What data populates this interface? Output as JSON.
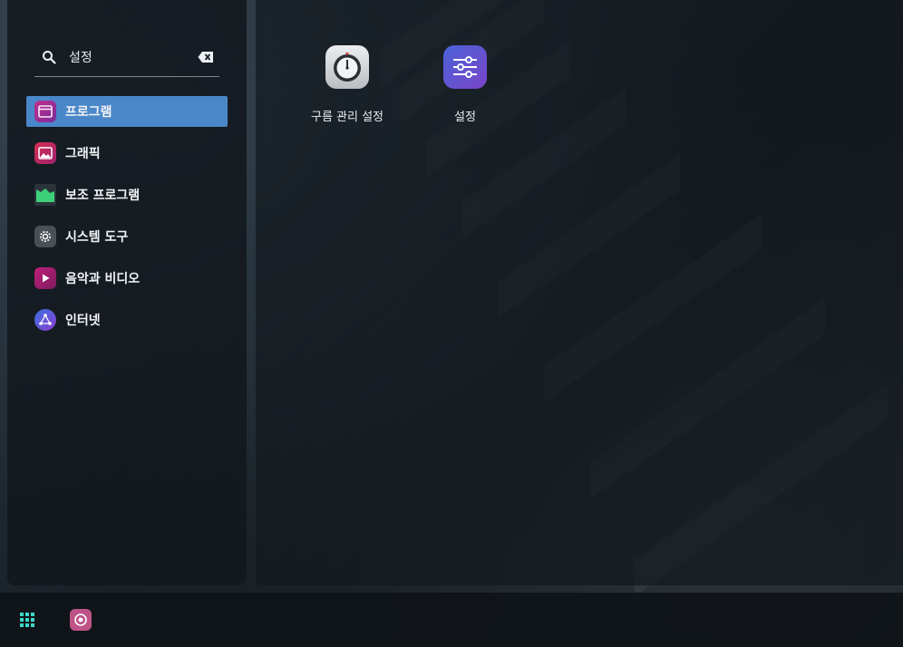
{
  "search": {
    "value": "설정"
  },
  "categories": [
    {
      "label": "프로그램",
      "icon": "window-icon",
      "active": true
    },
    {
      "label": "그래픽",
      "icon": "image-icon"
    },
    {
      "label": "보조 프로그램",
      "icon": "folder-chart-icon"
    },
    {
      "label": "시스템 도구",
      "icon": "gear-icon"
    },
    {
      "label": "음악과 비디오",
      "icon": "play-icon"
    },
    {
      "label": "인터넷",
      "icon": "network-icon"
    }
  ],
  "apps": [
    {
      "name": "구름 관리 설정",
      "icon": "stopwatch-icon"
    },
    {
      "name": "설정",
      "icon": "sliders-icon"
    }
  ],
  "taskbar": {
    "items": [
      "app-grid-icon",
      "camera-app-icon"
    ]
  },
  "colors": {
    "accent": "#4a87c9",
    "settings_icon": "#5b55d6"
  }
}
